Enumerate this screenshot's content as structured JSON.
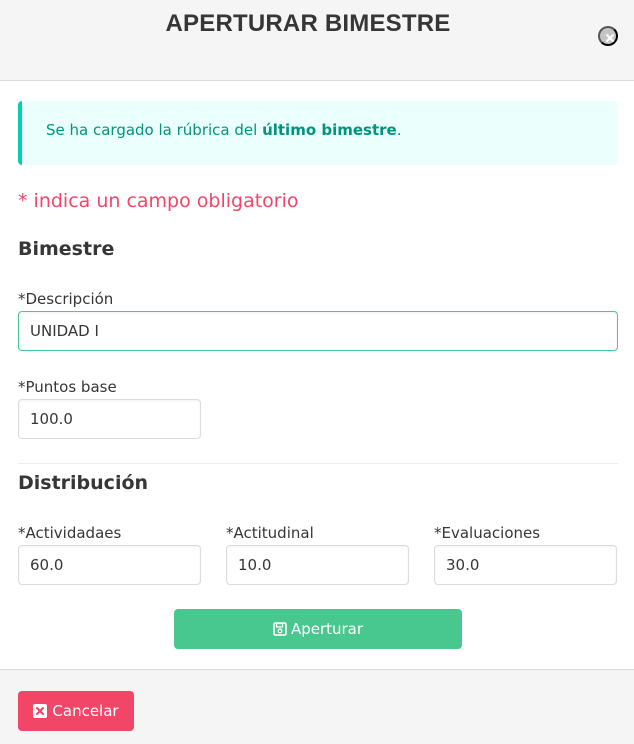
{
  "modal": {
    "title": "APERTURAR BIMESTRE"
  },
  "notice": {
    "text_before": "Se ha cargado la rúbrica del ",
    "text_strong": "último bimestre",
    "text_after": "."
  },
  "required_note": "* indica un campo obligatorio",
  "bimestre_section": {
    "title": "Bimestre",
    "descripcion": {
      "label": "*Descripción",
      "value": "UNIDAD I"
    },
    "puntos_base": {
      "label": "*Puntos base",
      "value": "100.0"
    }
  },
  "distribucion_section": {
    "title": "Distribución",
    "actividades": {
      "label": "*Actividadaes",
      "value": "60.0"
    },
    "actitudinal": {
      "label": "*Actitudinal",
      "value": "10.0"
    },
    "evaluaciones": {
      "label": "*Evaluaciones",
      "value": "30.0"
    }
  },
  "actions": {
    "aperturar_label": "Aperturar",
    "cancelar_label": "Cancelar"
  },
  "colors": {
    "success": "#48c78e",
    "danger": "#f14668",
    "notice_bg": "#ebfffc",
    "notice_text": "#00947e"
  },
  "icons": {
    "close": "close-icon",
    "save": "save-icon",
    "cancel": "cancel-x-icon"
  }
}
